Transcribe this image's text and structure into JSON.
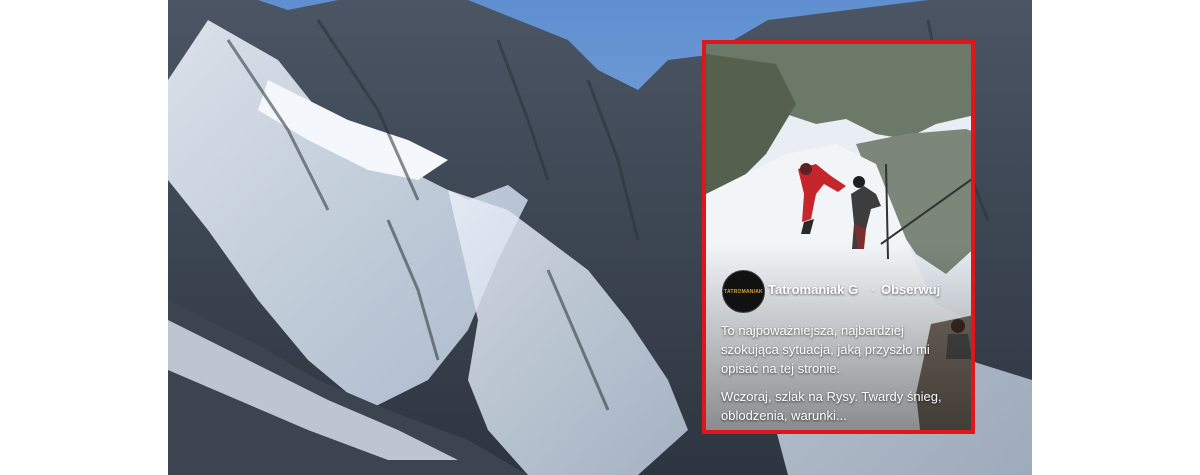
{
  "post": {
    "author": "Tatromaniak",
    "author_suffix": "G",
    "separator": "·",
    "follow_label": "Obserwuj",
    "avatar_text": "TATROMANIAK",
    "caption_line1": "To najpoważniejsza, najbardziej szokująca sytuacja, jaką przyszło mi opisać na tej stronie.",
    "caption_line2": "Wczoraj, szlak na Rysy. Twardy śnieg, oblodzenia, warunki..."
  },
  "colors": {
    "frame": "#e0161b",
    "sky": "#6f9bd6"
  }
}
